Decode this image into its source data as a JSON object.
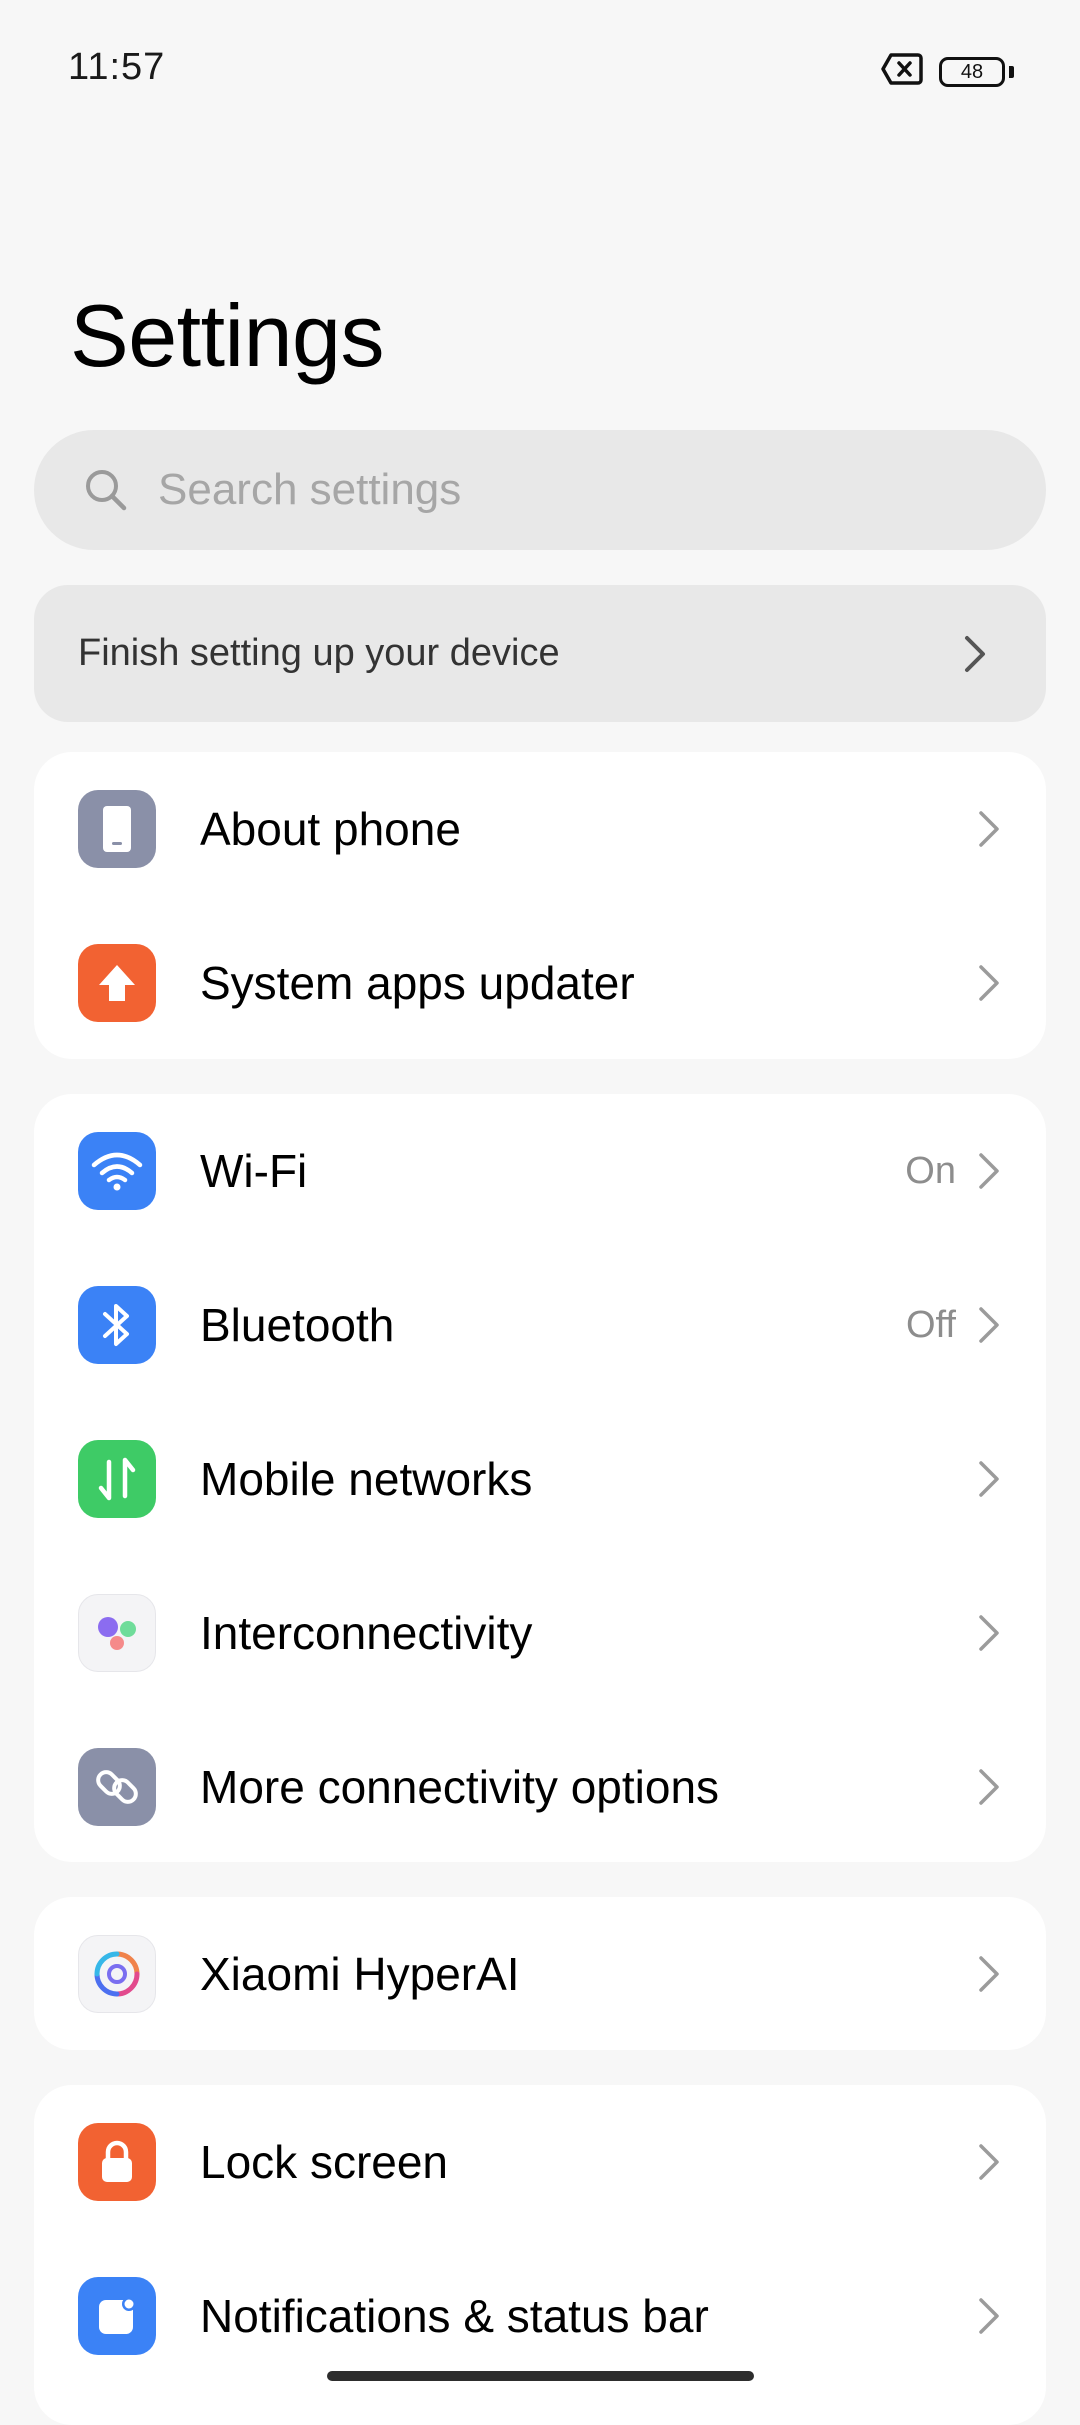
{
  "status_bar": {
    "time": "11:57",
    "battery_level": "48"
  },
  "header": {
    "title": "Settings"
  },
  "search": {
    "placeholder": "Search settings"
  },
  "finish_setup": {
    "label": "Finish setting up your device"
  },
  "groups": [
    {
      "items": [
        {
          "label": "About phone",
          "icon": "phone-icon",
          "color": "#8a90a8"
        },
        {
          "label": "System apps updater",
          "icon": "arrow-up-icon",
          "color": "#f26232"
        }
      ]
    },
    {
      "items": [
        {
          "label": "Wi-Fi",
          "value": "On",
          "icon": "wifi-icon",
          "color": "#3b82f6"
        },
        {
          "label": "Bluetooth",
          "value": "Off",
          "icon": "bluetooth-icon",
          "color": "#3b82f6"
        },
        {
          "label": "Mobile networks",
          "icon": "mobile-data-icon",
          "color": "#3ecb66"
        },
        {
          "label": "Interconnectivity",
          "icon": "interconnectivity-icon",
          "color": "#f4f4f6"
        },
        {
          "label": "More connectivity options",
          "icon": "link-icon",
          "color": "#8a90a8"
        }
      ]
    },
    {
      "items": [
        {
          "label": "Xiaomi HyperAI",
          "icon": "hyperai-icon",
          "color": "#f4f4f6"
        }
      ]
    },
    {
      "items": [
        {
          "label": "Lock screen",
          "icon": "lock-icon",
          "color": "#f26232"
        },
        {
          "label": "Notifications & status bar",
          "icon": "notification-icon",
          "color": "#3b82f6"
        }
      ]
    }
  ]
}
